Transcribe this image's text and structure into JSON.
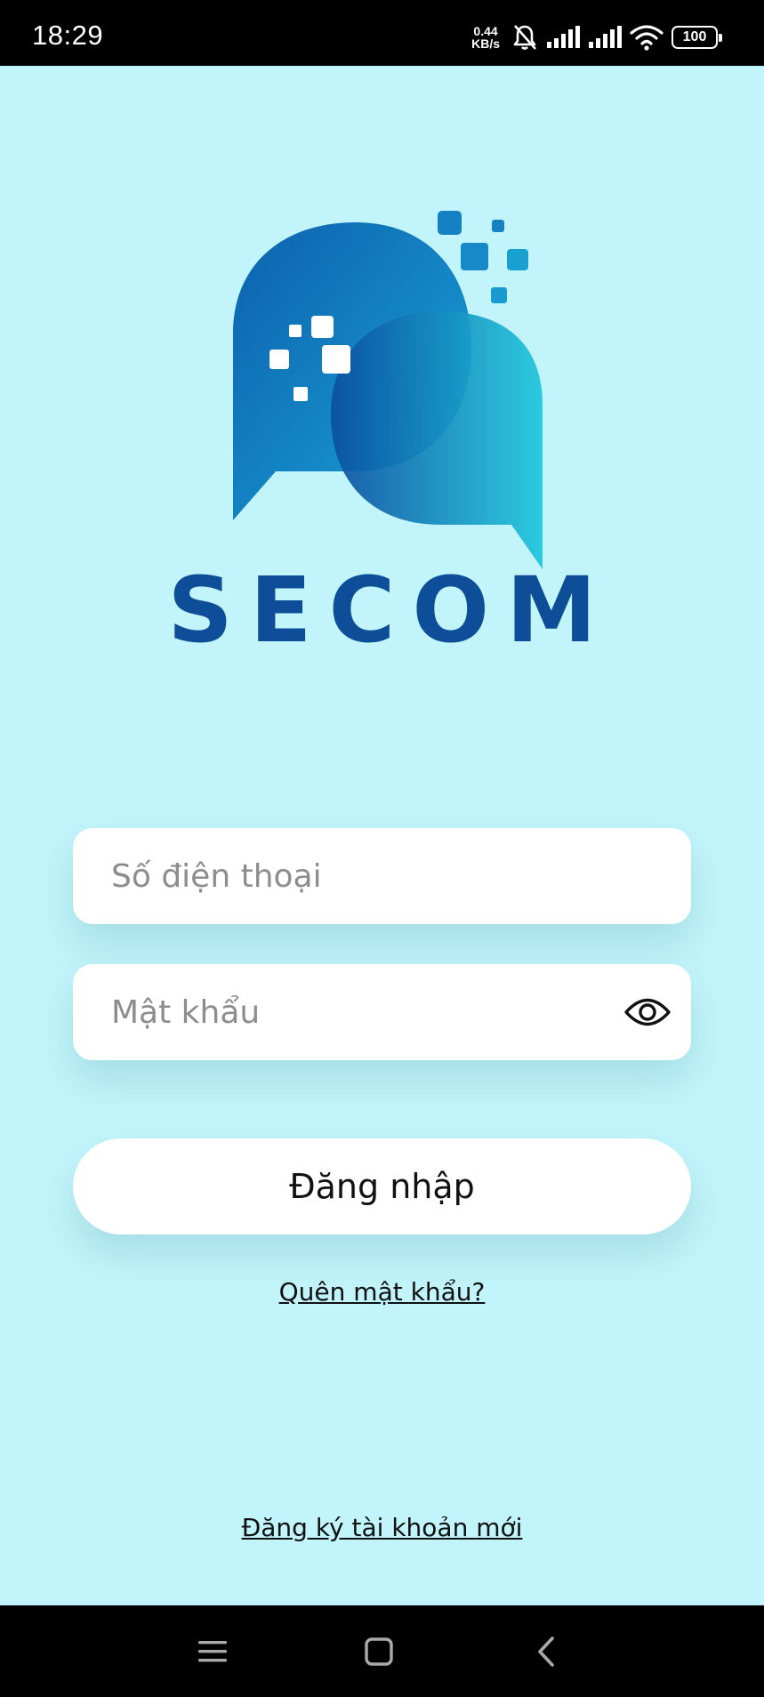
{
  "status_bar": {
    "time": "18:29",
    "net_speed_value": "0.44",
    "net_speed_unit": "KB/s",
    "battery": "100",
    "icons": [
      "mute-bell-icon",
      "signal-icon",
      "signal-icon",
      "wifi-icon",
      "battery-icon"
    ]
  },
  "brand": {
    "name": "SECOM",
    "colors": {
      "primary": "#0e4d98",
      "accent": "#1fb6d4",
      "background": "#c2f5fb"
    }
  },
  "form": {
    "phone_placeholder": "Số điện thoại",
    "phone_value": "",
    "password_placeholder": "Mật khẩu",
    "password_value": "",
    "password_toggle_icon": "eye-icon",
    "login_label": "Đăng nhập",
    "forgot_password_label": "Quên mật khẩu?",
    "register_label": "Đăng ký tài khoản mới"
  },
  "nav_bar": {
    "icons": [
      "menu-icon",
      "home-icon",
      "back-icon"
    ]
  }
}
